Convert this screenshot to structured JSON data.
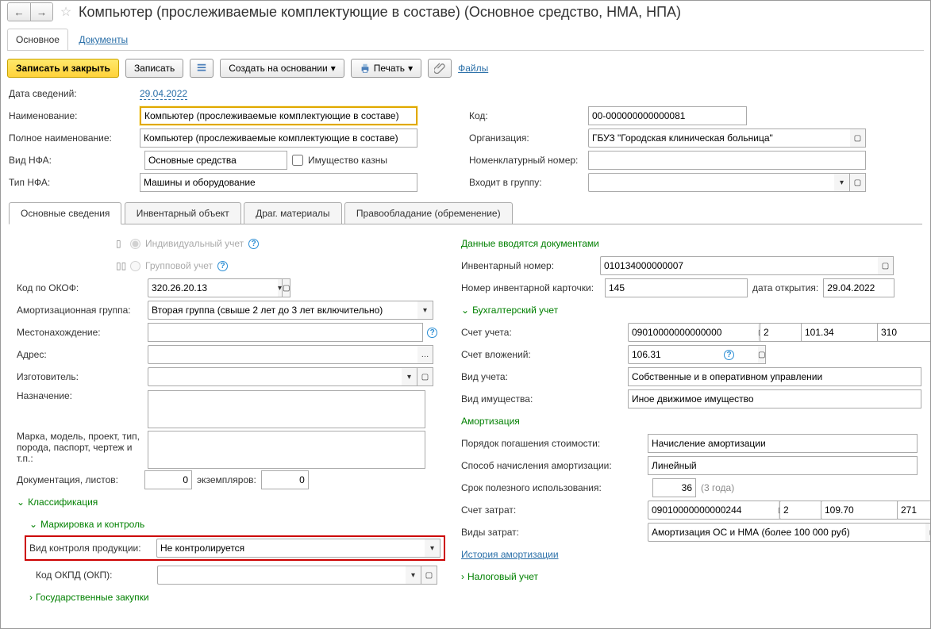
{
  "header": {
    "title": "Компьютер (прослеживаемые комплектующие в составе) (Основное средство, НМА, НПА)"
  },
  "topTabs": {
    "main": "Основное",
    "docs": "Документы"
  },
  "toolbar": {
    "saveClose": "Записать и закрыть",
    "save": "Записать",
    "createBased": "Создать на основании",
    "print": "Печать",
    "files": "Файлы"
  },
  "fields": {
    "dateLabel": "Дата сведений:",
    "date": "29.04.2022",
    "nameLabel": "Наименование:",
    "name": "Компьютер (прослеживаемые комплектующие в составе)",
    "fullNameLabel": "Полное наименование:",
    "fullName": "Компьютер (прослеживаемые комплектующие в составе)",
    "nfaTypeLabel": "Вид НФА:",
    "nfaType": "Основные средства",
    "treasuryLabel": "Имущество казны",
    "nfaType2Label": "Тип НФА:",
    "nfaType2": "Машины и оборудование",
    "codeLabel": "Код:",
    "code": "00-000000000000081",
    "orgLabel": "Организация:",
    "org": "ГБУЗ \"Городская клиническая больница\"",
    "nomLabel": "Номенклатурный номер:",
    "nom": "",
    "groupLabel": "Входит в группу:",
    "group": ""
  },
  "tabs": [
    "Основные сведения",
    "Инвентарный объект",
    "Драг. материалы",
    "Правообладание (обременение)"
  ],
  "paneL": {
    "individualAcc": "Индивидуальный учет",
    "groupAcc": "Групповой учет",
    "okofLabel": "Код по ОКОФ:",
    "okof": "320.26.20.13",
    "amortGroupLabel": "Амортизационная группа:",
    "amortGroup": "Вторая группа (свыше 2 лет до 3 лет включительно)",
    "locationLabel": "Местонахождение:",
    "addressLabel": "Адрес:",
    "manufacturerLabel": "Изготовитель:",
    "purposeLabel": "Назначение:",
    "modelLabel": "Марка, модель, проект, тип, порода, паспорт, чертеж и т.п.:",
    "docsLabel": "Документация, листов:",
    "docsVal": "0",
    "copiesLabel": "экземпляров:",
    "copiesVal": "0",
    "classification": "Классификация",
    "marking": "Маркировка и контроль",
    "controlTypeLabel": "Вид контроля продукции:",
    "controlType": "Не контролируется",
    "okpdLabel": "Код ОКПД (ОКП):",
    "govPurchases": "Государственные закупки"
  },
  "paneR": {
    "enteredByDocs": "Данные вводятся документами",
    "invNoLabel": "Инвентарный номер:",
    "invNo": "010134000000007",
    "cardNoLabel": "Номер инвентарной карточки:",
    "cardNo": "145",
    "openDateLabel": "дата открытия:",
    "openDate": "29.04.2022",
    "buhHead": "Бухгалтерский учет",
    "acctLabel": "Счет учета:",
    "acct": [
      "09010000000000000",
      "2",
      "101.34",
      "310"
    ],
    "investLabel": "Счет вложений:",
    "invest": "106.31",
    "acctTypeLabel": "Вид учета:",
    "acctType": "Собственные и в оперативном управлении",
    "propTypeLabel": "Вид имущества:",
    "propType": "Иное движимое имущество",
    "amortHead": "Амортизация",
    "repayLabel": "Порядок погашения стоимости:",
    "repay": "Начисление амортизации",
    "methodLabel": "Способ начисления амортизации:",
    "method": "Линейный",
    "usefulLabel": "Срок полезного использования:",
    "useful": "36",
    "usefulYears": "(3 года)",
    "costAcctLabel": "Счет затрат:",
    "costAcct": [
      "09010000000000244",
      "2",
      "109.70",
      "271"
    ],
    "costTypeLabel": "Виды затрат:",
    "costType": "Амортизация ОС и НМА (более 100 000 руб)",
    "amortHistory": "История амортизации",
    "taxHead": "Налоговый учет"
  }
}
